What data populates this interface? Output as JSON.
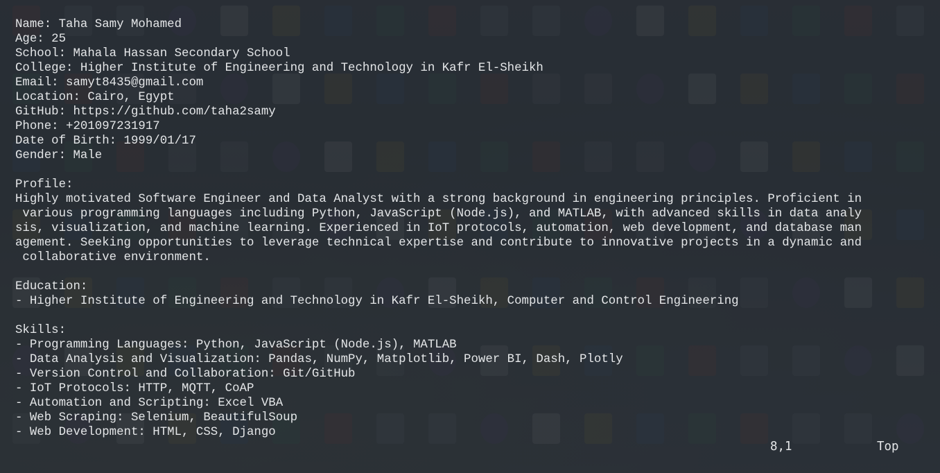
{
  "editor": {
    "lines": [
      "Name: Taha Samy Mohamed",
      "Age: 25",
      "School: Mahala Hassan Secondary School",
      "College: Higher Institute of Engineering and Technology in Kafr El-Sheikh",
      "Email: samyt8435@gmail.com",
      "Location: Cairo, Egypt",
      "GitHub: https://github.com/taha2samy",
      "Phone: +201097231917",
      "Date of Birth: 1999/01/17",
      "Gender: Male",
      "",
      "Profile:",
      "Highly motivated Software Engineer and Data Analyst with a strong background in engineering principles. Proficient in",
      " various programming languages including Python, JavaScript (Node.js), and MATLAB, with advanced skills in data analy",
      "sis, visualization, and machine learning. Experienced in IoT protocols, automation, web development, and database man",
      "agement. Seeking opportunities to leverage technical expertise and contribute to innovative projects in a dynamic and",
      " collaborative environment.",
      "",
      "Education:",
      "- Higher Institute of Engineering and Technology in Kafr El-Sheikh, Computer and Control Engineering",
      "",
      "Skills:",
      "- Programming Languages: Python, JavaScript (Node.js), MATLAB",
      "- Data Analysis and Visualization: Pandas, NumPy, Matplotlib, Power BI, Dash, Plotly",
      "- Version Control and Collaboration: Git/GitHub",
      "- IoT Protocols: HTTP, MQTT, CoAP",
      "- Automation and Scripting: Excel VBA",
      "- Web Scraping: Selenium, BeautifulSoup",
      "- Web Development: HTML, CSS, Django"
    ]
  },
  "statusline": {
    "cursor_position": "8,1",
    "scroll_position": "Top"
  },
  "colors": {
    "text": "#e4e6e8",
    "background": "#262c32"
  }
}
